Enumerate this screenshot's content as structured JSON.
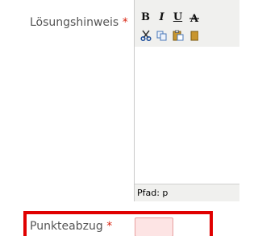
{
  "solution_hint": {
    "label": "Lösungshinweis",
    "required_marker": "*",
    "editor": {
      "toolbar_row1": [
        {
          "icon": "bold-icon",
          "glyph": "B"
        },
        {
          "icon": "italic-icon",
          "glyph": "I"
        },
        {
          "icon": "underline-icon",
          "glyph": "U"
        },
        {
          "icon": "strikethrough-icon",
          "glyph": "A"
        }
      ],
      "toolbar_row2": [
        {
          "icon": "cut-icon"
        },
        {
          "icon": "copy-icon"
        },
        {
          "icon": "paste-icon"
        },
        {
          "icon": "paste-text-icon"
        }
      ],
      "content": "",
      "status_path": "Pfad: p"
    }
  },
  "point_deduction": {
    "label": "Punkteabzug",
    "required_marker": "*",
    "value": "",
    "highlight_color": "#e00000",
    "input_background": "#fde4e4"
  }
}
